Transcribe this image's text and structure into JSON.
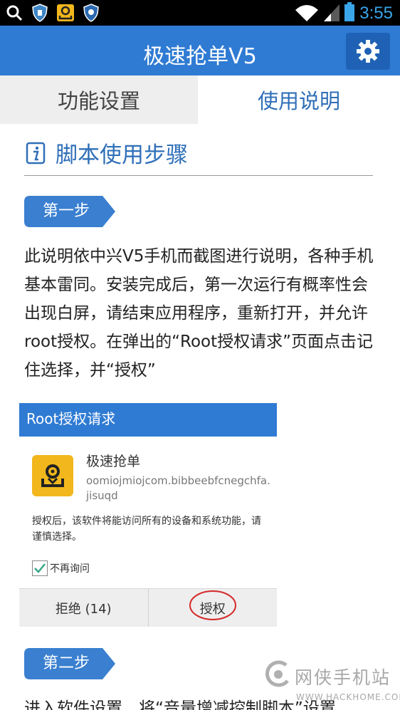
{
  "status_bar": {
    "time": "3:55",
    "left_icons": [
      "search-icon",
      "shield-icon",
      "location-icon",
      "badge-icon"
    ],
    "right_icons": [
      "wifi-icon",
      "signal-icon",
      "battery-icon"
    ]
  },
  "header": {
    "title": "极速抢单V5",
    "settings_icon": "gear-icon"
  },
  "tabs": [
    {
      "label": "功能设置",
      "active": false
    },
    {
      "label": "使用说明",
      "active": true
    }
  ],
  "section": {
    "title": "脚本使用步骤",
    "icon": "info-icon"
  },
  "steps": [
    {
      "label": "第一步"
    },
    {
      "label": "第二步"
    }
  ],
  "step1_text": "此说明依中兴V5手机而截图进行说明，各种手机基本雷同。安装完成后，第一次运行有概率性会出现白屏，请结束应用程序，重新打开，并允许root授权。在弹出的“Root授权请求”页面点击记住选择，并“授权”",
  "dialog": {
    "title": "Root授权请求",
    "app_name": "极速抢单",
    "package": "oomiojmiojcom.bibbeebfcnegchfa.jisuqd",
    "warning": "授权后，该软件将能访问所有的设备和系统功能，请谨慎选择。",
    "checkbox_label": "不再询问",
    "checkbox_checked": true,
    "deny_label": "拒绝 (14)",
    "grant_label": "授权"
  },
  "step2_text": "进入软件设置，将“音量增减控制脚本”设置",
  "watermark": {
    "name": "网侠手机站",
    "url": "WWW.HACKHOME.COM"
  },
  "colors": {
    "primary": "#2f7bd3",
    "accent_text": "#2f6fb8",
    "clock": "#3aa5e8",
    "highlight_circle": "#d42a2a"
  }
}
